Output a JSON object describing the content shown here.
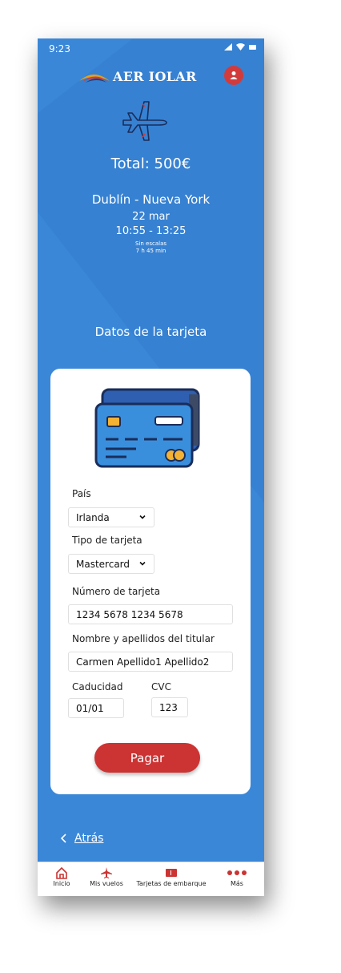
{
  "status_bar": {
    "time": "9:23"
  },
  "header": {
    "brand": "AER IOLAR"
  },
  "booking": {
    "total": "Total: 500€",
    "route": "Dublín - Nueva York",
    "date": "22 mar",
    "times": "10:55 - 13:25",
    "stops": "Sin escalas",
    "duration": "7 h 45 min"
  },
  "form": {
    "section_title": "Datos de la tarjeta",
    "country_label": "País",
    "country_value": "Irlanda",
    "card_type_label": "Tipo de tarjeta",
    "card_type_value": "Mastercard",
    "card_number_label": "Número de tarjeta",
    "card_number_value": "1234 5678 1234 5678",
    "holder_label": "Nombre y apellidos del titular",
    "holder_value": "Carmen Apellido1 Apellido2",
    "expiry_label": "Caducidad",
    "expiry_value": "01/01",
    "cvc_label": "CVC",
    "cvc_value": "123",
    "pay_button": "Pagar"
  },
  "back_link": {
    "label": "Atrás"
  },
  "bottom_nav": {
    "items": [
      {
        "label": "Inicio",
        "icon": "home-icon"
      },
      {
        "label": "Mis vuelos",
        "icon": "plane-icon"
      },
      {
        "label": "Tarjetas de embarque",
        "icon": "boarding-pass-icon"
      },
      {
        "label": "Más",
        "icon": "more-icon"
      }
    ]
  },
  "colors": {
    "background": "#3a87d8",
    "accent": "#cc3333",
    "panel": "#ffffff"
  }
}
